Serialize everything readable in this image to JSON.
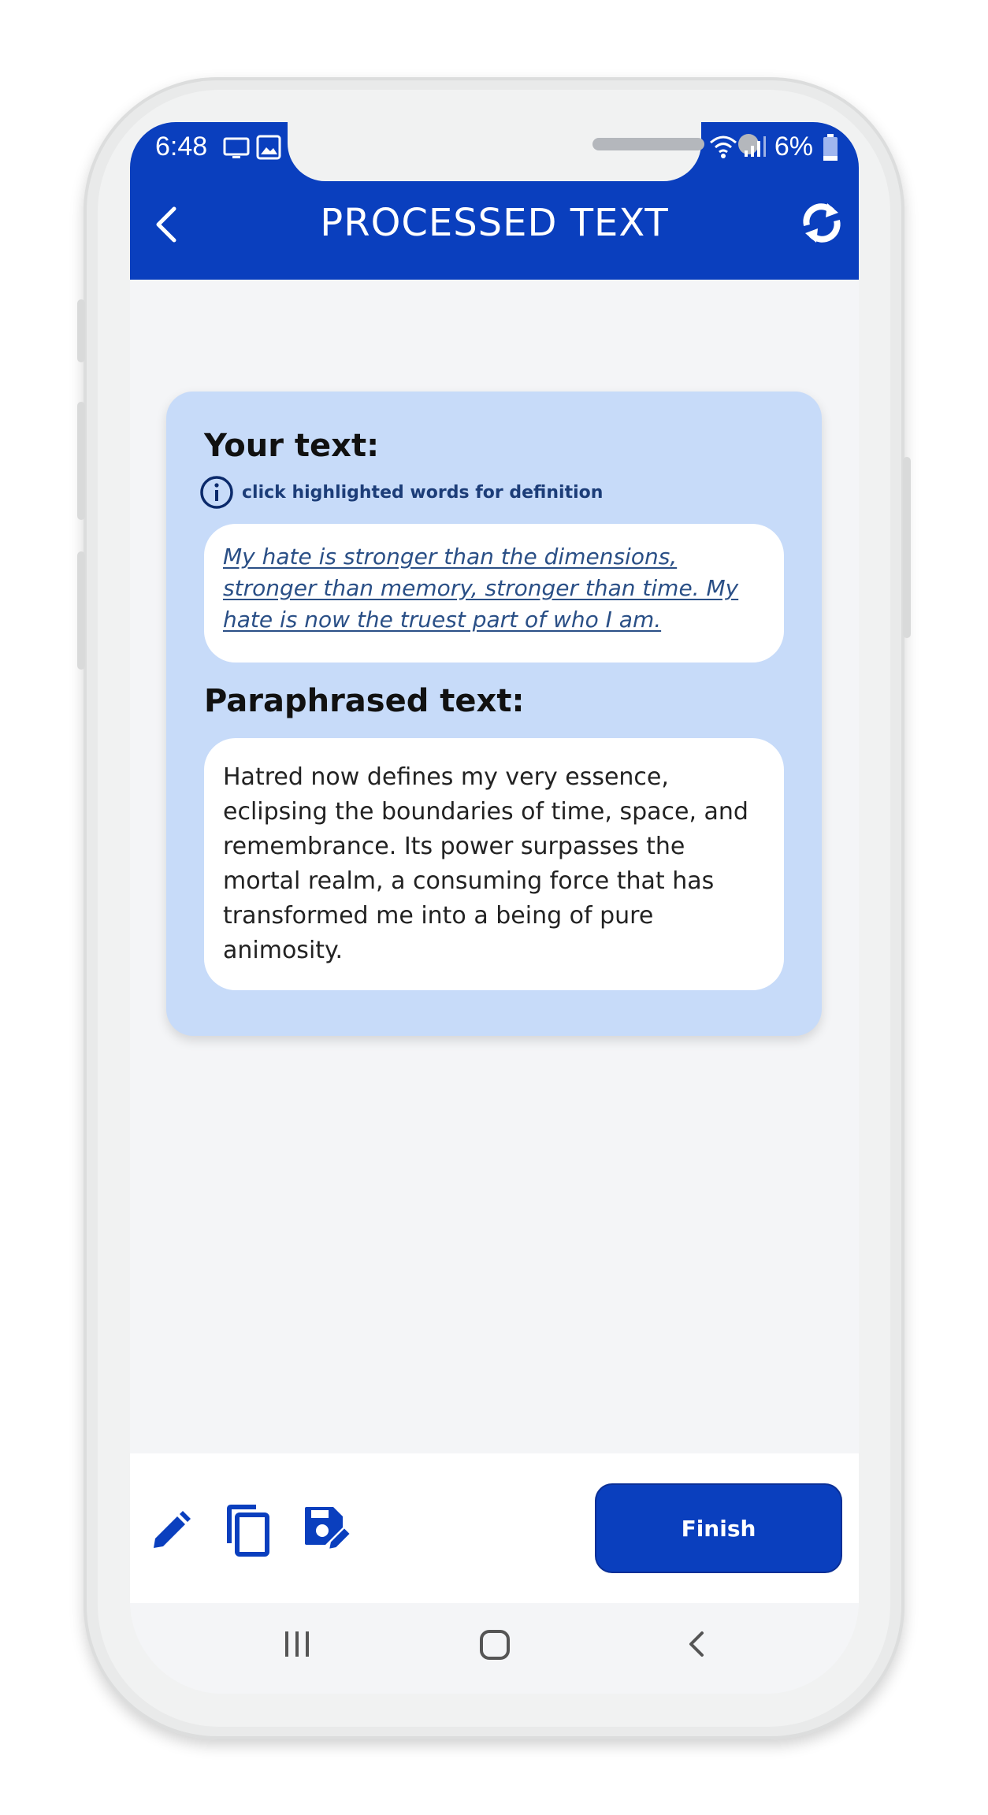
{
  "status": {
    "time": "6:48",
    "battery": "6%"
  },
  "header": {
    "title": "PROCESSED TEXT"
  },
  "card": {
    "your_text_title": "Your text:",
    "hint": "click highlighted words for definition",
    "original_text": "My hate is stronger than the dimensions, stronger than memory, stronger than time. My hate is now the truest part of who I am.",
    "paraphrased_title": "Paraphrased text:",
    "paraphrased_text": "Hatred now defines my very essence, eclipsing the boundaries of time, space, and remembrance. Its power surpasses the mortal realm, a consuming force that has transformed me into a being of pure animosity."
  },
  "toolbar": {
    "finish_label": "Finish"
  },
  "colors": {
    "primary": "#0a3fbe",
    "card_bg": "#c7dbf9",
    "screen_bg": "#f4f5f7"
  },
  "icons": [
    "back-icon",
    "refresh-icon",
    "info-icon",
    "edit-icon",
    "copy-icon",
    "save-icon",
    "recents-icon",
    "home-icon",
    "nav-back-icon"
  ]
}
